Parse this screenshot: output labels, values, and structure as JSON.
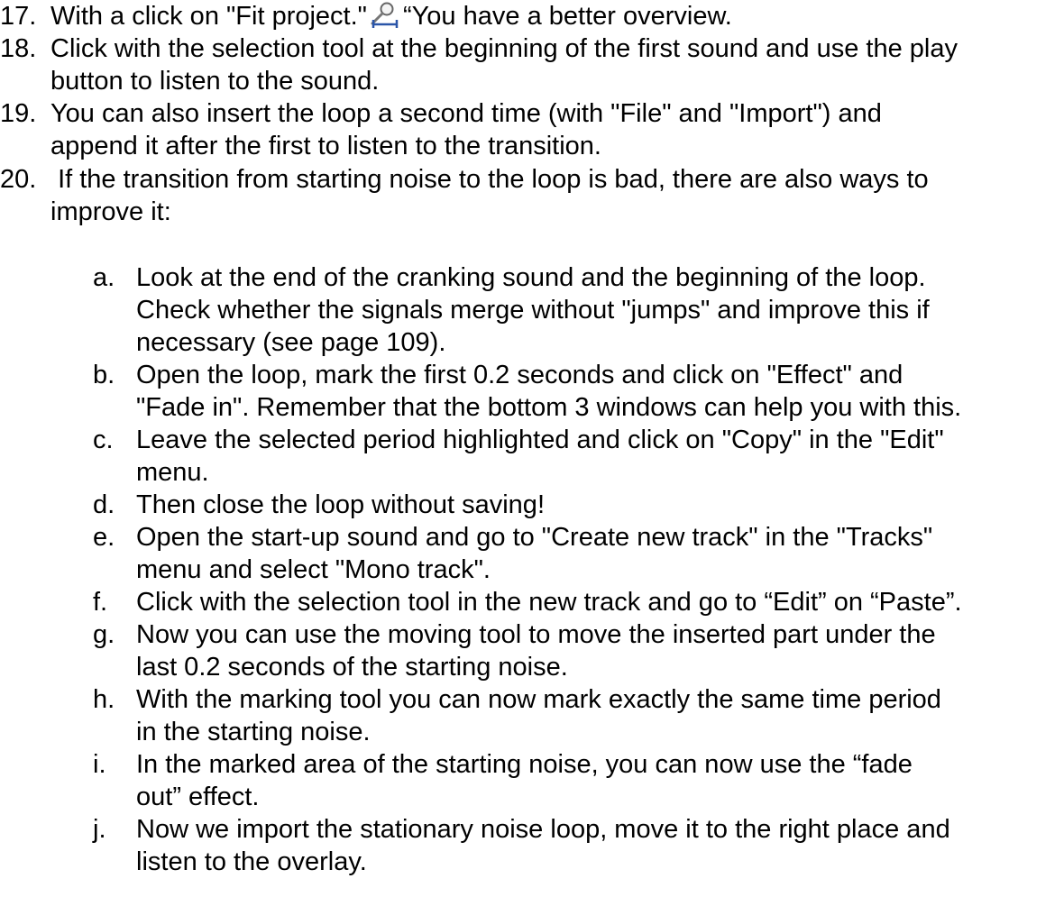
{
  "steps": [
    {
      "number": "17.",
      "text_before_icon": "With a click on \"Fit project.\"",
      "icon": "zoom-fit-icon",
      "text_after_icon": "“You have a better overview."
    },
    {
      "number": "18.",
      "line1": "Click with the selection tool at the beginning of the first sound and use the play",
      "line2": "button to listen to the sound."
    },
    {
      "number": "19.",
      "line1": "You can also insert the loop a second time (with \"File\" and \"Import\") and",
      "line2": "append it after the first to listen to the transition."
    },
    {
      "number": "20.",
      "line1": " If the transition from starting noise to the loop is bad, there are also ways to",
      "line2": "improve it:"
    }
  ],
  "substeps": [
    {
      "letter": "a.",
      "lines": [
        "Look at the end of the cranking sound and the beginning of the loop.",
        "Check whether the signals merge without \"jumps\" and improve this if",
        "necessary (see page 109)."
      ]
    },
    {
      "letter": "b.",
      "lines": [
        "Open the loop, mark the first 0.2 seconds and click on \"Effect\" and",
        "\"Fade in\". Remember that the bottom 3 windows can help you with this."
      ]
    },
    {
      "letter": "c.",
      "lines": [
        "Leave the selected period highlighted and click on \"Copy\" in the \"Edit\"",
        "menu."
      ]
    },
    {
      "letter": "d.",
      "lines": [
        "Then close the loop without saving!"
      ]
    },
    {
      "letter": "e.",
      "lines": [
        "Open the start-up sound and go to \"Create new track\" in the \"Tracks\"",
        "menu and select \"Mono track\"."
      ]
    },
    {
      "letter": "f.",
      "lines": [
        "Click with the selection tool in the new track and go to “Edit” on “Paste”."
      ]
    },
    {
      "letter": "g.",
      "lines": [
        "Now you can use the moving tool to move the inserted part under the",
        "last 0.2 seconds of the starting noise."
      ]
    },
    {
      "letter": "h.",
      "lines": [
        "With the marking tool you can now mark exactly the same time period",
        "in the starting noise."
      ]
    },
    {
      "letter": "i.",
      "lines": [
        "In the marked area of the starting noise, you can now use the “fade",
        "out” effect."
      ]
    },
    {
      "letter": "j.",
      "lines": [
        "Now we import the stationary noise loop, move it to the right place and",
        "listen to the overlay."
      ]
    }
  ]
}
